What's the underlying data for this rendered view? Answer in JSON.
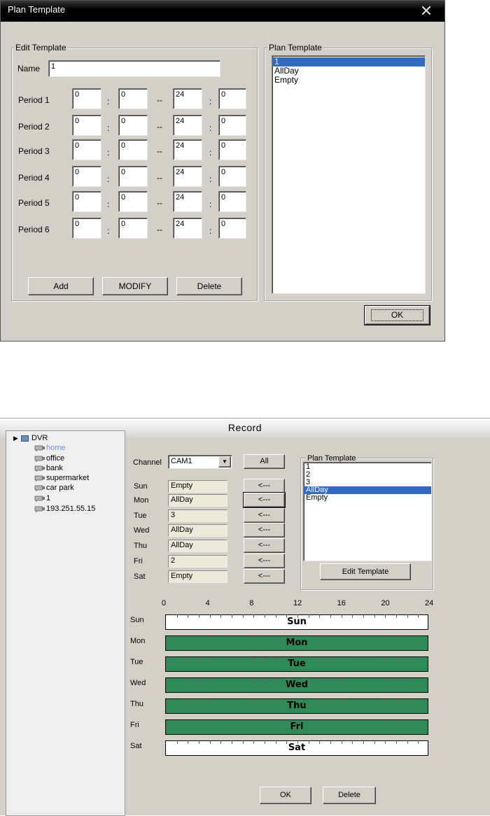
{
  "dialog1": {
    "title": "Plan Template",
    "edit_group_label": "Edit Template",
    "name_label": "Name",
    "name_value": "1",
    "periods": [
      {
        "label": "Period 1",
        "start_h": "0",
        "start_m": "0",
        "end_h": "24",
        "end_m": "0"
      },
      {
        "label": "Period 2",
        "start_h": "0",
        "start_m": "0",
        "end_h": "24",
        "end_m": "0"
      },
      {
        "label": "Period 3",
        "start_h": "0",
        "start_m": "0",
        "end_h": "24",
        "end_m": "0"
      },
      {
        "label": "Period 4",
        "start_h": "0",
        "start_m": "0",
        "end_h": "24",
        "end_m": "0"
      },
      {
        "label": "Period 5",
        "start_h": "0",
        "start_m": "0",
        "end_h": "24",
        "end_m": "0"
      },
      {
        "label": "Period 6",
        "start_h": "0",
        "start_m": "0",
        "end_h": "24",
        "end_m": "0"
      }
    ],
    "colon": ":",
    "dash": "--",
    "add_label": "Add",
    "modify_label": "MODIFY",
    "delete_label": "Delete",
    "plan_group_label": "Plan Template",
    "plan_list": [
      "1",
      "AllDay",
      "Empty"
    ],
    "plan_selected": "1",
    "ok_label": "OK",
    "close_icon": "close-icon"
  },
  "dialog2": {
    "title": "Record",
    "tree": {
      "root": "DVR",
      "items": [
        "home",
        "office",
        "bank",
        "supermarket",
        "car park",
        "1",
        "193.251.55.15"
      ],
      "highlighted": "home"
    },
    "channel_label": "Channel",
    "channel_value": "CAM1",
    "all_label": "All",
    "days": [
      {
        "day": "Sun",
        "value": "Empty",
        "arrow": "<---"
      },
      {
        "day": "Mon",
        "value": "AllDay",
        "arrow": "<---"
      },
      {
        "day": "Tue",
        "value": "3",
        "arrow": "<---"
      },
      {
        "day": "Wed",
        "value": "AllDay",
        "arrow": "<---"
      },
      {
        "day": "Thu",
        "value": "AllDay",
        "arrow": "<---"
      },
      {
        "day": "Fri",
        "value": "2",
        "arrow": "<---"
      },
      {
        "day": "Sat",
        "value": "Empty",
        "arrow": "<---"
      }
    ],
    "plan_group_label": "Plan Template",
    "plan_list": [
      "1",
      "2",
      "3",
      "AllDay",
      "Empty"
    ],
    "plan_selected": "AllDay",
    "edit_template_label": "Edit Template",
    "scale": [
      "0",
      "4",
      "8",
      "12",
      "16",
      "20",
      "24"
    ],
    "schedule": [
      {
        "day": "Sun",
        "bar_label": "Sun",
        "filled": false
      },
      {
        "day": "Mon",
        "bar_label": "Mon",
        "filled": true
      },
      {
        "day": "Tue",
        "bar_label": "Tue",
        "filled": true
      },
      {
        "day": "Wed",
        "bar_label": "Wed",
        "filled": true
      },
      {
        "day": "Thu",
        "bar_label": "Thu",
        "filled": true
      },
      {
        "day": "Fri",
        "bar_label": "Fri",
        "filled": true
      },
      {
        "day": "Sat",
        "bar_label": "Sat",
        "filled": false
      }
    ],
    "ok_label": "OK",
    "delete_label": "Delete",
    "colors": {
      "bar_fill": "#2e8b57",
      "bar_empty": "#ffffff",
      "selection": "#316ac5",
      "tree_highlight": "#6f8fe8"
    }
  }
}
